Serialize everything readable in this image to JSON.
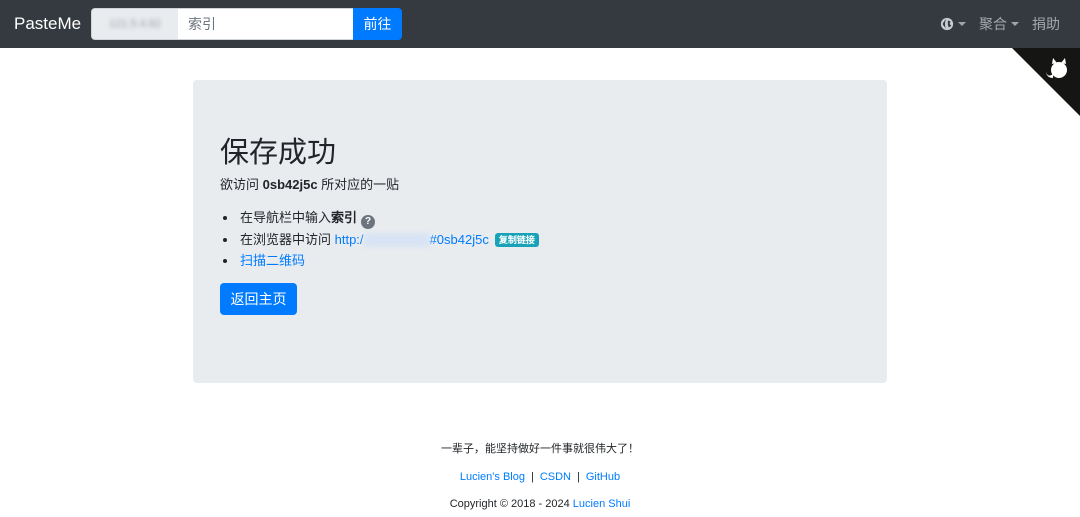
{
  "navbar": {
    "brand": "PasteMe",
    "prefix": "121.5.4.82",
    "search_placeholder": "索引",
    "go_label": "前往",
    "aggregate_label": "聚合",
    "donate_label": "捐助"
  },
  "main": {
    "title": "保存成功",
    "lead_prefix": "欲访问 ",
    "key": "0sb42j5c",
    "lead_suffix": " 所对应的一贴",
    "step1_prefix": "在导航栏中输入",
    "step1_bold": "索引",
    "step1_hint": "?",
    "step2_prefix": "在浏览器中访问 ",
    "step2_link_start": "http:/",
    "step2_link_end": "#0sb42j5c",
    "copy_badge": "复制链接",
    "step3_link": "扫描二维码",
    "home_button": "返回主页"
  },
  "footer": {
    "motto": "一辈子，能坚持做好一件事就很伟大了！",
    "links": [
      "Lucien's Blog",
      "CSDN",
      "GitHub"
    ],
    "separator": "|",
    "copyright_prefix": "Copyright © 2018 - 2024 ",
    "author": "Lucien Shui"
  },
  "colors": {
    "navbar": "#343a40",
    "primary": "#007bff",
    "info": "#17a2b8",
    "jumbotron": "#e9ecef"
  }
}
